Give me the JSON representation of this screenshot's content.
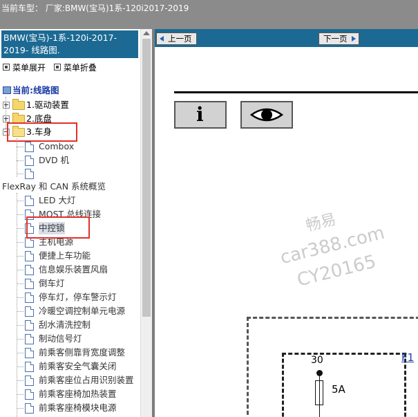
{
  "header": {
    "title": "当前车型：  厂家:BMW(宝马)1系-120i2017-2019"
  },
  "sidebar": {
    "heading": "BMW(宝马)-1系-120i-2017-2019- 线路图.",
    "expand_label": "菜单展开",
    "collapse_label": "菜单折叠",
    "current_label": "当前:线路图",
    "folders": [
      "1.驱动装置",
      "2.底盘",
      "3.车身"
    ],
    "items": [
      "Combox",
      "DVD 机",
      "",
      "FlexRay 和 CAN 系统概览",
      "LED 大灯",
      "MOST 总线连接",
      "中控锁",
      "主机电源",
      "便捷上车功能",
      "信息娱乐装置风扇",
      "倒车灯",
      "停车灯，停车警示灯",
      "冷暖空调控制单元电源",
      "刮水清洗控制",
      "制动信号灯",
      "前乘客侧靠背宽度调整",
      "前乘客安全气囊关闭",
      "前乘客座位占用识别装置",
      "前乘客座椅加热装置",
      "前乘客座椅模块电源"
    ]
  },
  "nav": {
    "prev_label": "上一页",
    "next_label": "下一页"
  },
  "toolbar": {
    "info_label": "i"
  },
  "watermark": {
    "line1": "畅易",
    "line2": "car388.com",
    "line3": "CY20165"
  },
  "diagram": {
    "fuse_number": "30",
    "fuse_rating": "5A",
    "link_label": "F1"
  },
  "colors": {
    "accent": "#1c6a93",
    "highlight": "#e0302a",
    "topbar": "#8b8b8b"
  }
}
